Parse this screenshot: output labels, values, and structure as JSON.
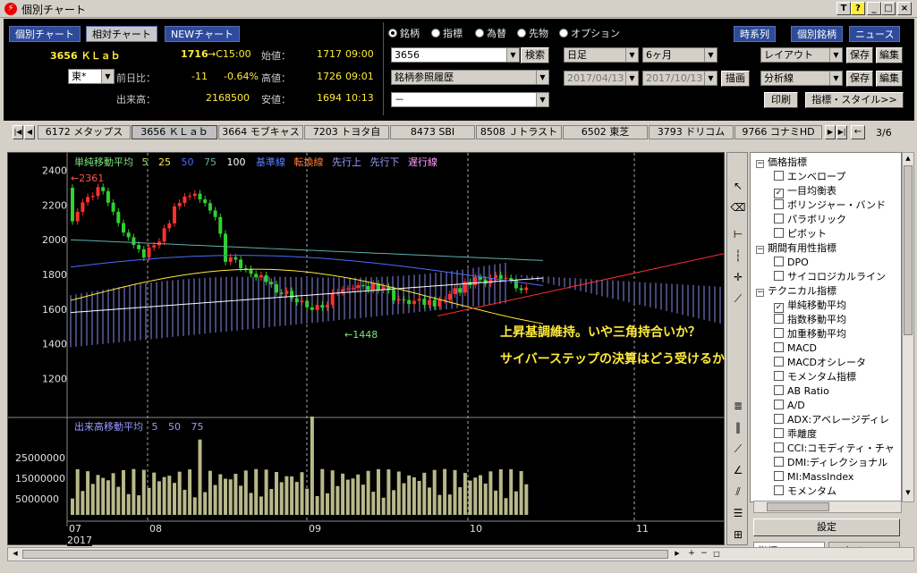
{
  "window": {
    "title": "個別チャート",
    "btn_t": "T",
    "btn_help": "?",
    "btn_min": "_",
    "btn_max": "□",
    "btn_close": "×"
  },
  "top_tabs": [
    "個別チャート",
    "相対チャート",
    "NEWチャート"
  ],
  "quote": {
    "code_name": "3656 ＫＬａｂ",
    "price": "1716",
    "time": "→C15:00",
    "open_label": "始値：",
    "open_val": "1717",
    "open_time": "09:00",
    "market": "東*",
    "change_label": "前日比：",
    "change": "-11",
    "change_pct": "-0.64%",
    "high_label": "高値：",
    "high_val": "1726",
    "high_time": "09:01",
    "volume_label": "出来高：",
    "volume": "2168500",
    "low_label": "安値：",
    "low_val": "1694",
    "low_time": "10:13"
  },
  "modes": {
    "meigara": "銘柄",
    "shihyo": "指標",
    "kawase": "為替",
    "sakimono": "先物",
    "option": "オプション"
  },
  "search": {
    "code": "3656",
    "search_btn": "検索",
    "history": "銘柄参照履歴",
    "third": "－"
  },
  "period": {
    "bar": "日足",
    "range": "6ヶ月",
    "from": "2017/04/13",
    "to": "2017/10/13",
    "draw_btn": "描画"
  },
  "right_buttons": {
    "timeseries": "時系列",
    "individual": "個別銘柄",
    "news": "ニュース",
    "layout": "レイアウト",
    "save": "保存",
    "edit": "編集",
    "analysis": "分析線",
    "print": "印刷",
    "indicator_style": "指標・スタイル>>"
  },
  "stock_tabs": [
    "6172 メタップス",
    "3656 ＫＬａｂ",
    "3664 モブキャス",
    "7203 トヨタ自",
    "8473 SBI",
    "8508 Ｊトラスト",
    "6502 東芝",
    "3793 ドリコム",
    "9766 コナミHD"
  ],
  "stock_page": "3/6",
  "legend": {
    "ma": "単純移動平均",
    "p5": "5",
    "p25": "25",
    "p50": "50",
    "p75": "75",
    "p100": "100",
    "kijun": "基準線",
    "tenkan": "転換線",
    "senkou_up": "先行上",
    "senkou_down": "先行下",
    "chikou": "遅行線"
  },
  "volume_legend": {
    "title": "出来高移動平均",
    "p5": "5",
    "p50": "50",
    "p75": "75"
  },
  "annotations": {
    "line1": "上昇基調維持。いや三角持合いか？",
    "line2": "サイバーステップの決算はどう受けるか",
    "high_mark": "←2361",
    "low_mark": "←1448"
  },
  "y_ticks": [
    "2400",
    "2200",
    "2000",
    "1800",
    "1600",
    "1400",
    "1200"
  ],
  "vol_ticks": [
    "25000000",
    "15000000",
    "5000000"
  ],
  "x_ticks": [
    "07",
    "08",
    "09",
    "10",
    "11"
  ],
  "year_label": "2017",
  "indicator_tree": [
    {
      "type": "group",
      "label": "価格指標"
    },
    {
      "type": "item",
      "label": "エンベロープ",
      "checked": false
    },
    {
      "type": "item",
      "label": "一目均衡表",
      "checked": true
    },
    {
      "type": "item",
      "label": "ボリンジャー・バンド",
      "checked": false
    },
    {
      "type": "item",
      "label": "パラボリック",
      "checked": false
    },
    {
      "type": "item",
      "label": "ピボット",
      "checked": false
    },
    {
      "type": "group",
      "label": "期間有用性指標"
    },
    {
      "type": "item",
      "label": "DPO",
      "checked": false
    },
    {
      "type": "item",
      "label": "サイコロジカルライン",
      "checked": false
    },
    {
      "type": "group",
      "label": "テクニカル指標"
    },
    {
      "type": "item",
      "label": "単純移動平均",
      "checked": true
    },
    {
      "type": "item",
      "label": "指数移動平均",
      "checked": false
    },
    {
      "type": "item",
      "label": "加重移動平均",
      "checked": false
    },
    {
      "type": "item",
      "label": "MACD",
      "checked": false
    },
    {
      "type": "item",
      "label": "MACDオシレータ",
      "checked": false
    },
    {
      "type": "item",
      "label": "モメンタム指標",
      "checked": false
    },
    {
      "type": "item",
      "label": "AB Ratio",
      "checked": false
    },
    {
      "type": "item",
      "label": "A/D",
      "checked": false
    },
    {
      "type": "item",
      "label": "ADX:アベレージディレ",
      "checked": false
    },
    {
      "type": "item",
      "label": "乖離度",
      "checked": false
    },
    {
      "type": "item",
      "label": "CCI:コモディティ・チャ",
      "checked": false
    },
    {
      "type": "item",
      "label": "DMI:ディレクショナル",
      "checked": false
    },
    {
      "type": "item",
      "label": "MI:MassIndex",
      "checked": false
    },
    {
      "type": "item",
      "label": "モメンタム",
      "checked": false
    }
  ],
  "settings_btn": "設定",
  "bottom_tabs": {
    "indicator": "指標",
    "style": "スタイル"
  }
}
